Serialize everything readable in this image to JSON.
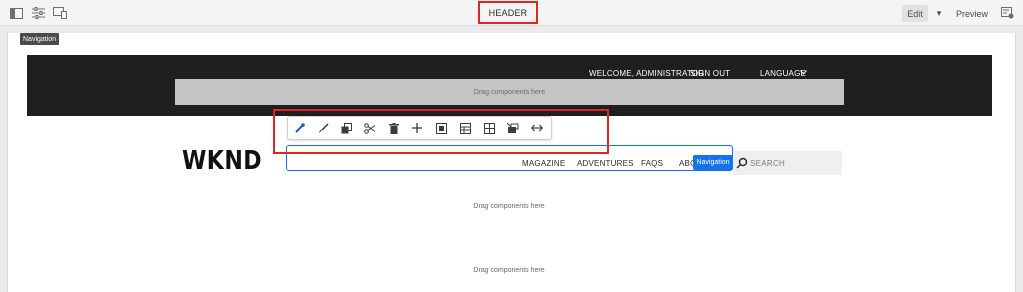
{
  "topbar": {
    "icons": [
      "side-panel-icon",
      "properties-icon",
      "emulator-icon",
      "page-info-icon"
    ],
    "highlight_label": "HEADER",
    "mode_edit": "Edit",
    "mode_caret": "▾",
    "mode_preview": "Preview"
  },
  "canvas": {
    "tooltip": "Navigation",
    "header": {
      "welcome": "WELCOME, ADMINISTRATOR",
      "sign_out": "SIGN OUT",
      "language": "LANGUAGE",
      "drag_here": "Drag components here"
    },
    "toolbar": {
      "icons": [
        "configure-icon",
        "style-icon",
        "copy-icon",
        "cut-icon",
        "delete-icon",
        "insert-icon",
        "group-icon",
        "layout-icon",
        "template-icon",
        "parent-icon",
        "expand-icon"
      ]
    },
    "logo": "WKND",
    "nav": {
      "items": [
        "MAGAZINE",
        "ADVENTURES",
        "FAQS",
        "ABO"
      ],
      "chip": "Navigation",
      "search_placeholder": "SEARCH"
    },
    "drop_zones": [
      "Drag components here",
      "Drag components here"
    ]
  },
  "colors": {
    "highlight": "#e0261f",
    "selection": "#1473e6",
    "dark_header": "#1f1f1f"
  }
}
